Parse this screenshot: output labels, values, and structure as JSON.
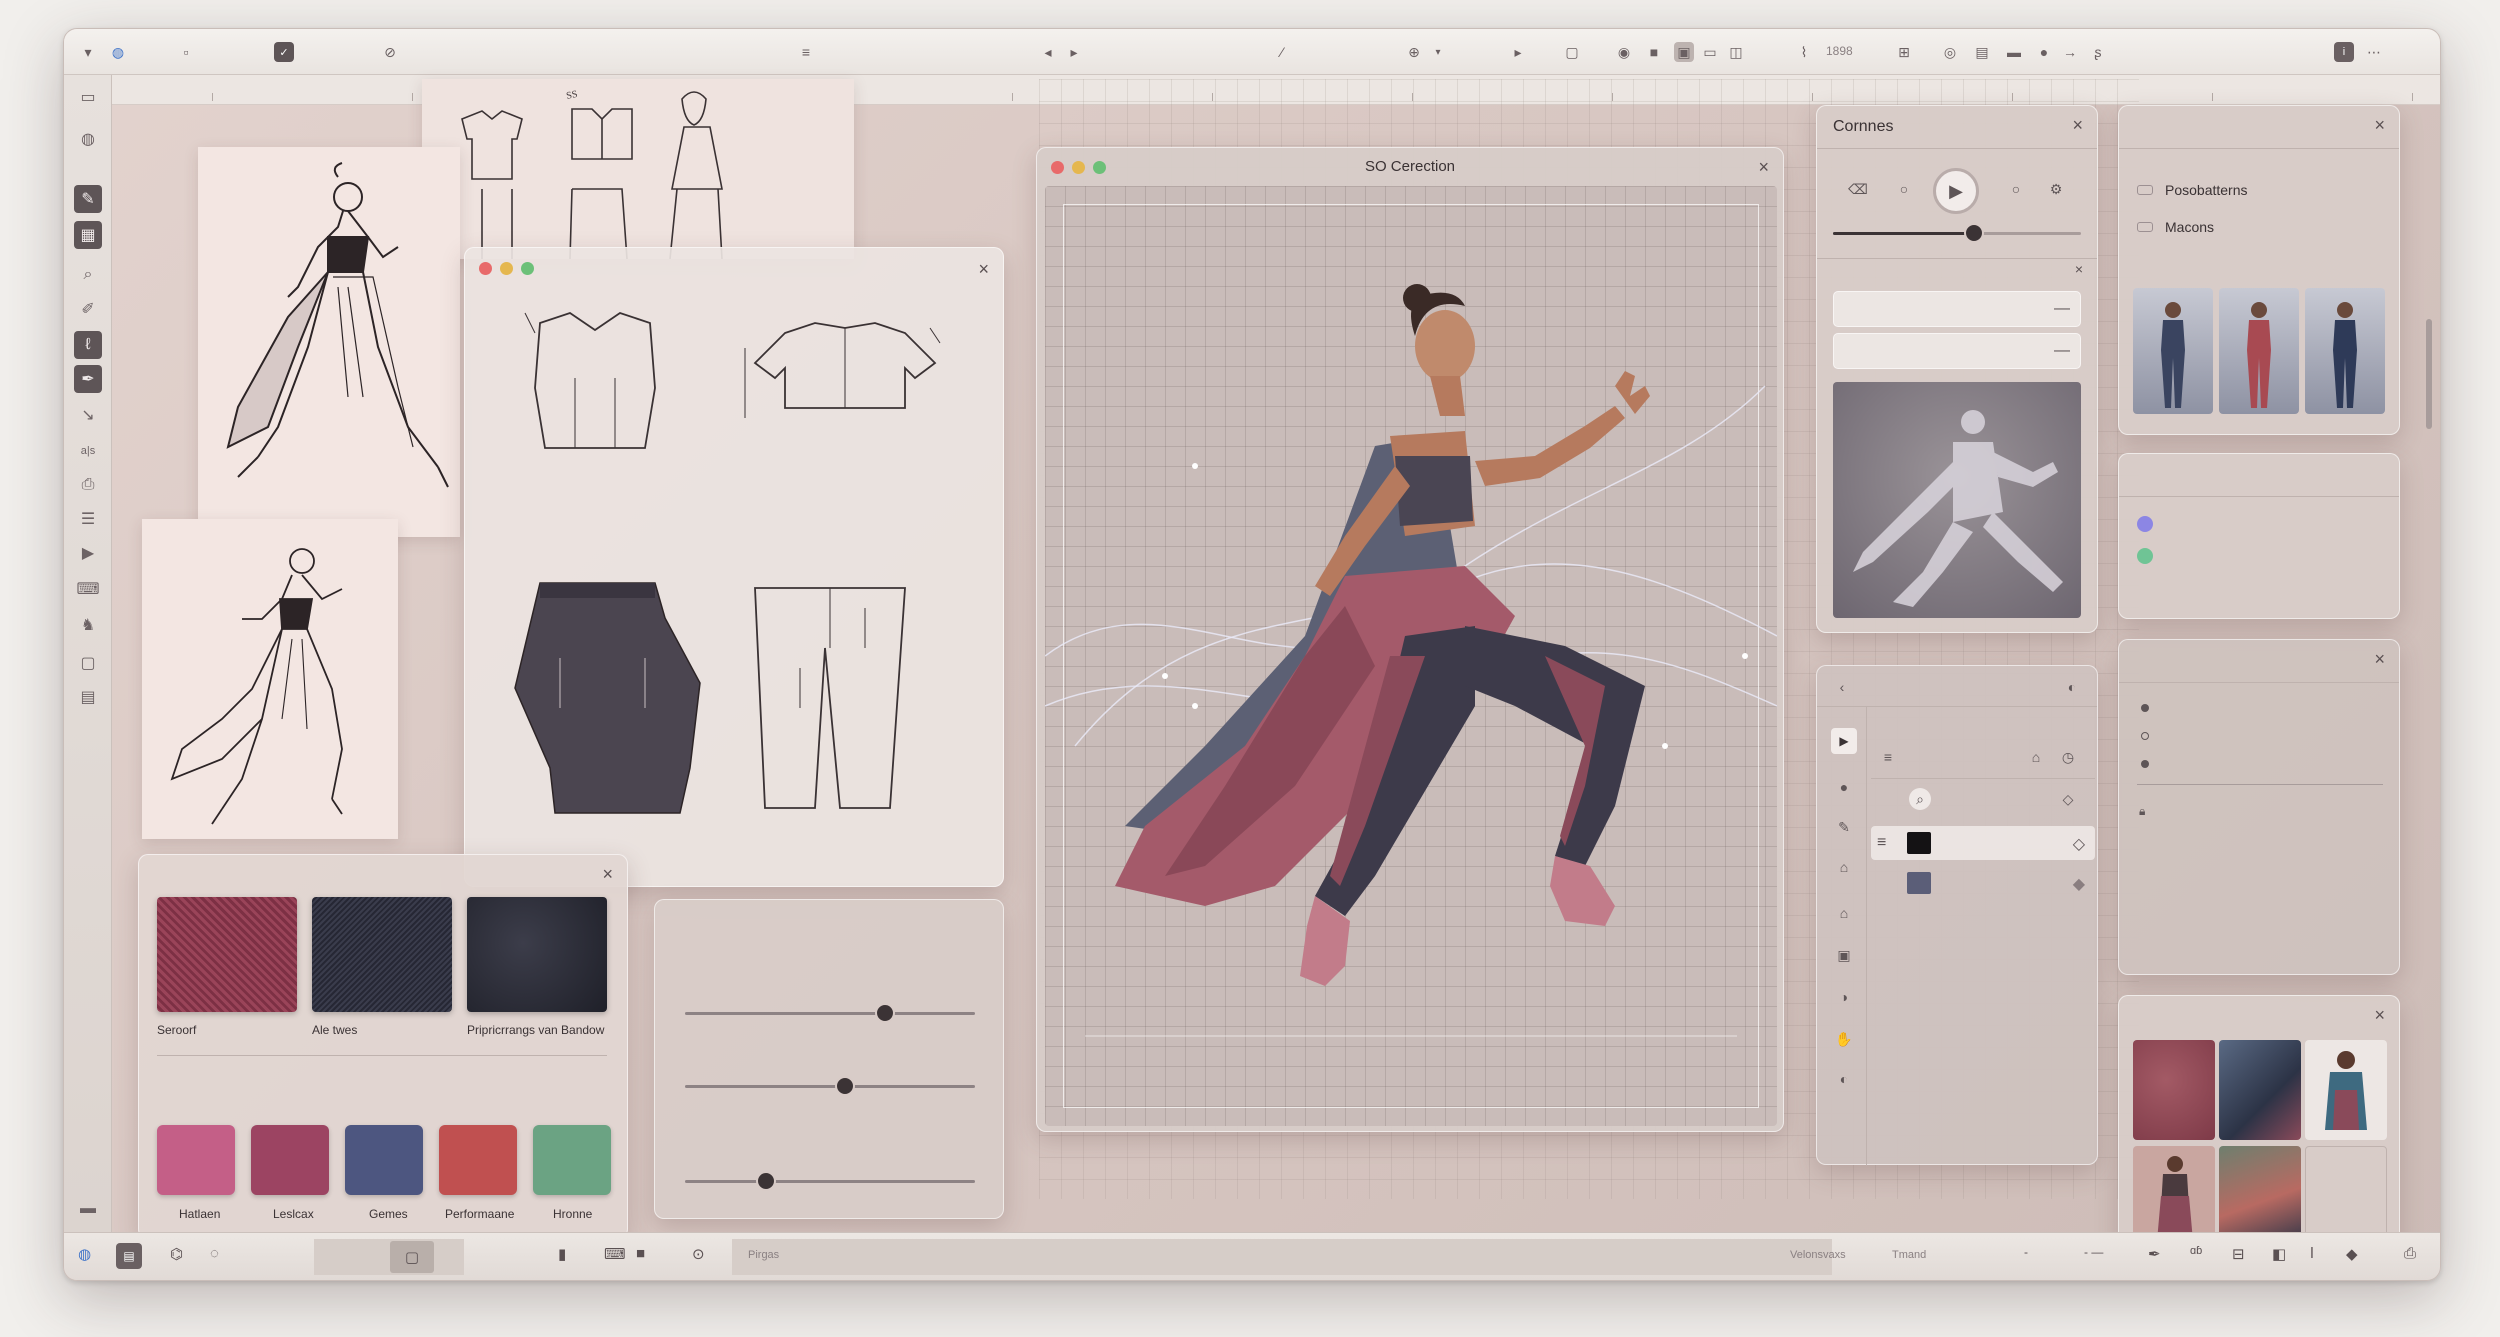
{
  "canvas_window": {
    "title": "SO Cerection"
  },
  "playback_panel": {
    "title": "Cornnes"
  },
  "references_panel": {
    "items": [
      "Posobatterns",
      "Macons"
    ]
  },
  "fabric_panel": {
    "fabrics": [
      {
        "label": "Seroorf",
        "color": "#8a3b4e"
      },
      {
        "label": "Ale twes",
        "color": "#2d2e3a"
      },
      {
        "label": "Pripricrrangs van Bandow",
        "color": "#25262f"
      }
    ],
    "colors": [
      {
        "label": "Hatlaen",
        "color": "#c45f87"
      },
      {
        "label": "Leslcax",
        "color": "#9c4462"
      },
      {
        "label": "Gemes",
        "color": "#4d5680"
      },
      {
        "label": "Performaane",
        "color": "#c05050"
      },
      {
        "label": "Hronne",
        "color": "#6ba383"
      }
    ]
  },
  "sliders": {
    "values": [
      0.69,
      0.55,
      0.28
    ]
  },
  "playback_slider": {
    "value": 0.57
  },
  "bottombar": {
    "pages_label": "Pirgas",
    "status_left": "Velonsvaxs",
    "status_right": "Tmand"
  },
  "topbar": {
    "zoom_label": "1898"
  },
  "accent_colors": {
    "dot_purple": "#8c86e4",
    "dot_green": "#6fc495",
    "swatch_black": "#141214",
    "swatch_slate": "#5b5e78"
  }
}
